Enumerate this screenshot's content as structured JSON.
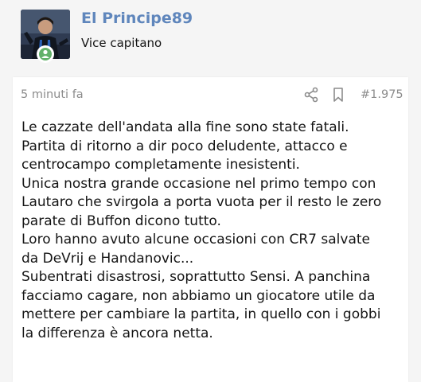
{
  "user": {
    "name": "El Principe89",
    "title": "Vice capitano"
  },
  "post": {
    "time": "5 minuti fa",
    "number": "#1.975",
    "lines": [
      "Le cazzate dell'andata alla fine sono state fatali.",
      "Partita di ritorno a dir poco deludente, attacco e",
      "centrocampo completamente inesistenti.",
      "Unica nostra grande occasione nel primo tempo con",
      "Lautaro che svirgola a porta vuota per il resto le zero",
      "parate di Buffon dicono tutto.",
      "Loro hanno avuto alcune occasioni con CR7 salvate",
      "da DeVrij e Handanovic...",
      "Subentrati disastrosi, soprattutto Sensi. A panchina",
      "facciamo cagare, non abbiamo un giocatore utile da",
      "mettere per cambiare la partita, in quello con i gobbi",
      "la differenza è ancora netta."
    ]
  },
  "icons": {
    "share": "share-icon",
    "bookmark": "bookmark-icon",
    "online": "online-status-icon"
  },
  "colors": {
    "username": "#5f86bc",
    "online": "#63b16a",
    "meta": "#8c8c8c"
  }
}
